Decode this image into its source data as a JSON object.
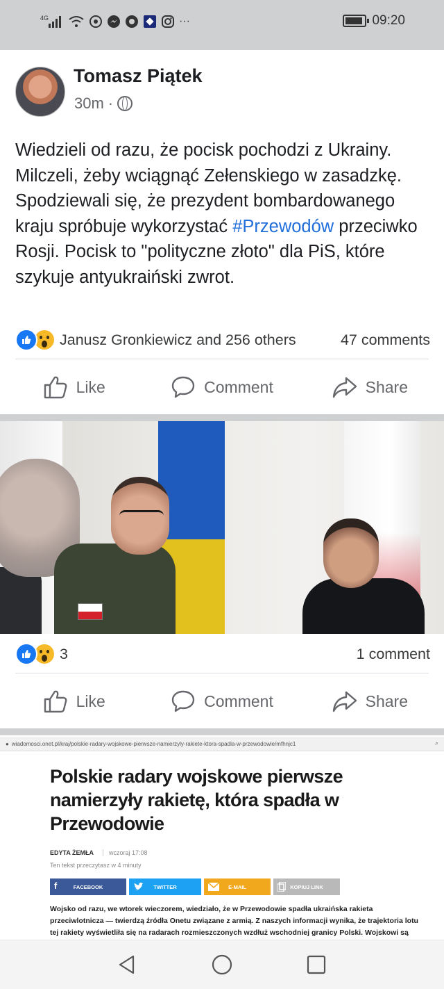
{
  "status_bar": {
    "network": "4G",
    "time": "09:20",
    "more": "···"
  },
  "post": {
    "author": "Tomasz Piątek",
    "time": "30m",
    "dot": "·",
    "text_part1": "Wiedzieli od razu, że pocisk pochodzi z Ukrainy. Milczeli, żeby wciągnąć Zełenskiego w zasadzkę. Spodziewali się, że prezydent bombardowanego kraju spróbuje wykorzystać ",
    "hashtag": "#Przewodów",
    "text_part2": " przeciwko Rosji. Pocisk to \"polityczne złoto\" dla PiS, które szykuje antyukraiński zwrot.",
    "reactions_names": "Janusz Gronkiewicz and 256 others",
    "comments": "47 comments"
  },
  "actions": {
    "like": "Like",
    "comment": "Comment",
    "share": "Share"
  },
  "photo_post": {
    "reaction_count": "3",
    "comments": "1 comment"
  },
  "article": {
    "url": "wiadomosci.onet.pl/kraj/polskie-radary-wojskowe-pierwsze-namierzyly-rakiete-ktora-spadla-w-przewodowie/mfhnjc1",
    "title": "Polskie radary wojskowe pierwsze namierzyły rakietę, która spadła w Przewodowie",
    "author": "EDYTA ŻEMŁA",
    "date": "wczoraj 17:08",
    "read_time": "Ten tekst przeczytasz w 4 minuty",
    "share_buttons": {
      "facebook": "FACEBOOK",
      "twitter": "TWITTER",
      "email": "E-MAIL",
      "copy": "KOPIUJ LINK"
    },
    "body": "Wojsko od razu, we wtorek wieczorem, wiedziało, że w Przewodowie spadła ukraińska rakieta przeciwlotnicza — twierdzą źródła Onetu związane z armią. Z naszych informacji wynika, że trajektoria lotu tej rakiety wyświetliła się na radarach rozmieszczonych wzdłuż wschodniej granicy Polski. Wojskowi są"
  },
  "icons": {
    "globe": "globe-icon",
    "like_reaction": "like-reaction-icon",
    "wow_reaction": "wow-reaction-icon",
    "back": "back-icon",
    "home": "home-icon",
    "recents": "recents-icon"
  },
  "colors": {
    "facebook_blue": "#1877f2",
    "hashtag": "#216fdb",
    "status_bar_bg": "#cfd0d2"
  }
}
